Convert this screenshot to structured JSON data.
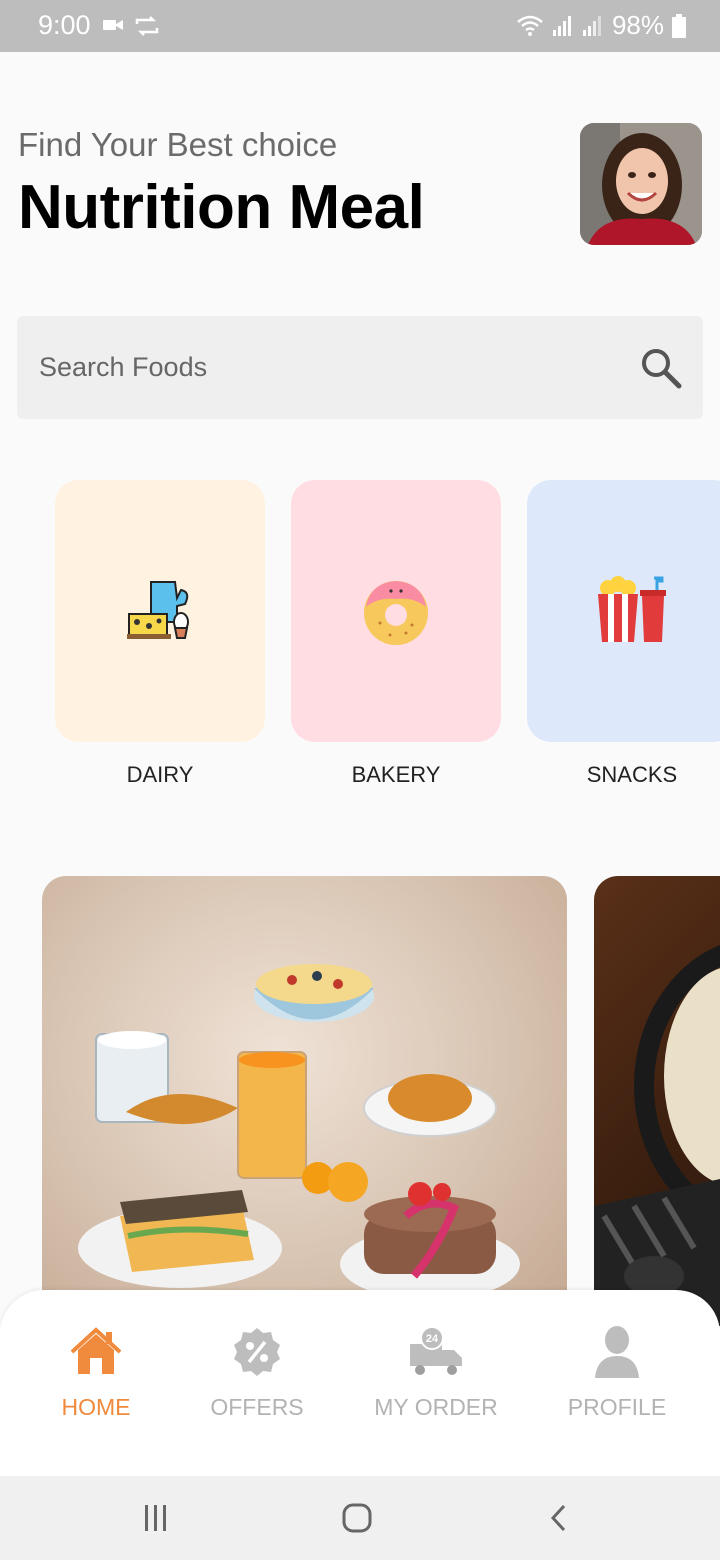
{
  "status": {
    "time": "9:00",
    "battery": "98%"
  },
  "header": {
    "subtitle": "Find Your Best choice",
    "title": "Nutrition Meal"
  },
  "search": {
    "placeholder": "Search Foods"
  },
  "categories": [
    {
      "label": "DAIRY",
      "color": "#fff2e0"
    },
    {
      "label": "BAKERY",
      "color": "#ffdde3"
    },
    {
      "label": "SNACKS",
      "color": "#dde9fb"
    }
  ],
  "nav": {
    "items": [
      {
        "label": "HOME",
        "icon": "home-icon",
        "active": true
      },
      {
        "label": "OFFERS",
        "icon": "discount-badge-icon",
        "active": false
      },
      {
        "label": "MY ORDER",
        "icon": "delivery-truck-icon",
        "active": false
      },
      {
        "label": "PROFILE",
        "icon": "user-icon",
        "active": false
      }
    ]
  },
  "colors": {
    "accent": "#f08a3c",
    "inactive": "#b3b3b3",
    "status_bar": "#bdbdbd"
  }
}
